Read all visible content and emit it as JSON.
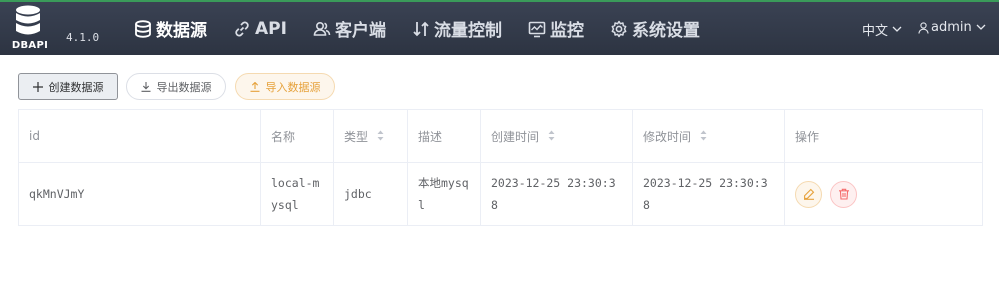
{
  "header": {
    "logo_text": "DBAPI",
    "version": "4.1.0",
    "nav": [
      {
        "label": "数据源",
        "icon": "database-icon",
        "active": true
      },
      {
        "label": "API",
        "icon": "link-icon",
        "active": false
      },
      {
        "label": "客户端",
        "icon": "users-icon",
        "active": false
      },
      {
        "label": "流量控制",
        "icon": "sort-arrows-icon",
        "active": false
      },
      {
        "label": "监控",
        "icon": "monitor-icon",
        "active": false
      },
      {
        "label": "系统设置",
        "icon": "gear-icon",
        "active": false
      }
    ],
    "language": "中文",
    "user": "admin"
  },
  "toolbar": {
    "create_label": "创建数据源",
    "export_label": "导出数据源",
    "import_label": "导入数据源"
  },
  "table": {
    "columns": [
      "id",
      "名称",
      "类型",
      "描述",
      "创建时间",
      "修改时间",
      "操作"
    ],
    "rows": [
      {
        "id": "qkMnVJmY",
        "name": "local-mysql",
        "type": "jdbc",
        "description": "本地mysql",
        "created": "2023-12-25 23:30:38",
        "modified": "2023-12-25 23:30:38"
      }
    ]
  },
  "colors": {
    "header_bg": "#2d3442",
    "accent_green": "#3a9b5a",
    "warning": "#e6a23c",
    "danger": "#f56c6c"
  }
}
